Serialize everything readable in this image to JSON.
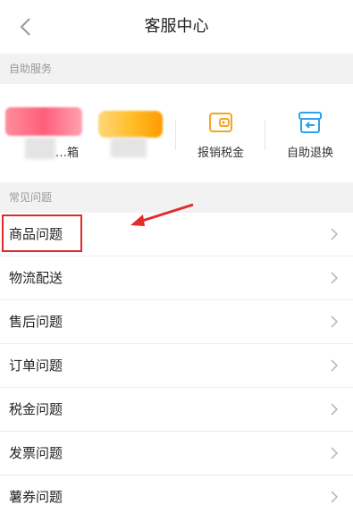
{
  "header": {
    "title": "客服中心",
    "back_icon": "chevron-left-icon"
  },
  "sections": {
    "self_service": "自助服务",
    "common_questions": "常见问题"
  },
  "services": [
    {
      "label": "…箱",
      "icon": "blurred-icon"
    },
    {
      "label": "箱",
      "icon": "blurred-icon"
    },
    {
      "label": "报销税金",
      "icon": "wallet-icon",
      "color": "#f5a623"
    },
    {
      "label": "自助退换",
      "icon": "return-box-icon",
      "color": "#2aa3e8"
    }
  ],
  "faq": [
    {
      "label": "商品问题"
    },
    {
      "label": "物流配送"
    },
    {
      "label": "售后问题"
    },
    {
      "label": "订单问题"
    },
    {
      "label": "税金问题"
    },
    {
      "label": "发票问题"
    },
    {
      "label": "薯券问题"
    }
  ],
  "colors": {
    "annotation": "#e22a2a",
    "section_bg": "#f2f2f2"
  }
}
